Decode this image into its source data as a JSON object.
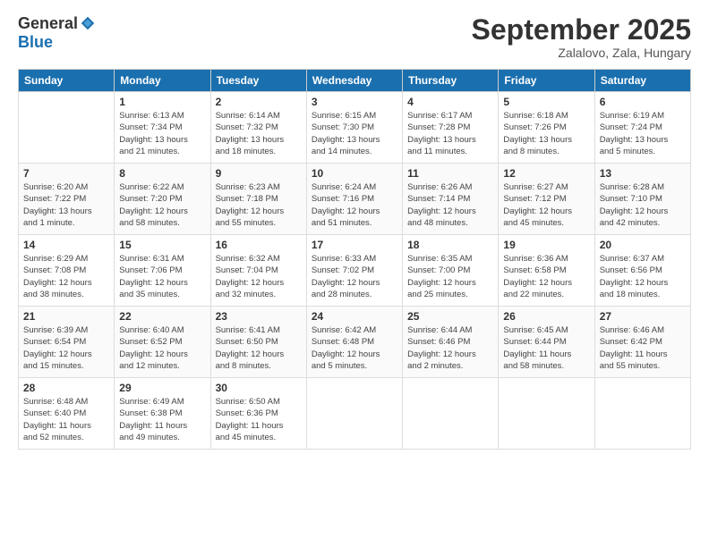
{
  "logo": {
    "general": "General",
    "blue": "Blue"
  },
  "header": {
    "month": "September 2025",
    "location": "Zalalovo, Zala, Hungary"
  },
  "weekdays": [
    "Sunday",
    "Monday",
    "Tuesday",
    "Wednesday",
    "Thursday",
    "Friday",
    "Saturday"
  ],
  "weeks": [
    [
      {
        "day": "",
        "info": ""
      },
      {
        "day": "1",
        "info": "Sunrise: 6:13 AM\nSunset: 7:34 PM\nDaylight: 13 hours\nand 21 minutes."
      },
      {
        "day": "2",
        "info": "Sunrise: 6:14 AM\nSunset: 7:32 PM\nDaylight: 13 hours\nand 18 minutes."
      },
      {
        "day": "3",
        "info": "Sunrise: 6:15 AM\nSunset: 7:30 PM\nDaylight: 13 hours\nand 14 minutes."
      },
      {
        "day": "4",
        "info": "Sunrise: 6:17 AM\nSunset: 7:28 PM\nDaylight: 13 hours\nand 11 minutes."
      },
      {
        "day": "5",
        "info": "Sunrise: 6:18 AM\nSunset: 7:26 PM\nDaylight: 13 hours\nand 8 minutes."
      },
      {
        "day": "6",
        "info": "Sunrise: 6:19 AM\nSunset: 7:24 PM\nDaylight: 13 hours\nand 5 minutes."
      }
    ],
    [
      {
        "day": "7",
        "info": "Sunrise: 6:20 AM\nSunset: 7:22 PM\nDaylight: 13 hours\nand 1 minute."
      },
      {
        "day": "8",
        "info": "Sunrise: 6:22 AM\nSunset: 7:20 PM\nDaylight: 12 hours\nand 58 minutes."
      },
      {
        "day": "9",
        "info": "Sunrise: 6:23 AM\nSunset: 7:18 PM\nDaylight: 12 hours\nand 55 minutes."
      },
      {
        "day": "10",
        "info": "Sunrise: 6:24 AM\nSunset: 7:16 PM\nDaylight: 12 hours\nand 51 minutes."
      },
      {
        "day": "11",
        "info": "Sunrise: 6:26 AM\nSunset: 7:14 PM\nDaylight: 12 hours\nand 48 minutes."
      },
      {
        "day": "12",
        "info": "Sunrise: 6:27 AM\nSunset: 7:12 PM\nDaylight: 12 hours\nand 45 minutes."
      },
      {
        "day": "13",
        "info": "Sunrise: 6:28 AM\nSunset: 7:10 PM\nDaylight: 12 hours\nand 42 minutes."
      }
    ],
    [
      {
        "day": "14",
        "info": "Sunrise: 6:29 AM\nSunset: 7:08 PM\nDaylight: 12 hours\nand 38 minutes."
      },
      {
        "day": "15",
        "info": "Sunrise: 6:31 AM\nSunset: 7:06 PM\nDaylight: 12 hours\nand 35 minutes."
      },
      {
        "day": "16",
        "info": "Sunrise: 6:32 AM\nSunset: 7:04 PM\nDaylight: 12 hours\nand 32 minutes."
      },
      {
        "day": "17",
        "info": "Sunrise: 6:33 AM\nSunset: 7:02 PM\nDaylight: 12 hours\nand 28 minutes."
      },
      {
        "day": "18",
        "info": "Sunrise: 6:35 AM\nSunset: 7:00 PM\nDaylight: 12 hours\nand 25 minutes."
      },
      {
        "day": "19",
        "info": "Sunrise: 6:36 AM\nSunset: 6:58 PM\nDaylight: 12 hours\nand 22 minutes."
      },
      {
        "day": "20",
        "info": "Sunrise: 6:37 AM\nSunset: 6:56 PM\nDaylight: 12 hours\nand 18 minutes."
      }
    ],
    [
      {
        "day": "21",
        "info": "Sunrise: 6:39 AM\nSunset: 6:54 PM\nDaylight: 12 hours\nand 15 minutes."
      },
      {
        "day": "22",
        "info": "Sunrise: 6:40 AM\nSunset: 6:52 PM\nDaylight: 12 hours\nand 12 minutes."
      },
      {
        "day": "23",
        "info": "Sunrise: 6:41 AM\nSunset: 6:50 PM\nDaylight: 12 hours\nand 8 minutes."
      },
      {
        "day": "24",
        "info": "Sunrise: 6:42 AM\nSunset: 6:48 PM\nDaylight: 12 hours\nand 5 minutes."
      },
      {
        "day": "25",
        "info": "Sunrise: 6:44 AM\nSunset: 6:46 PM\nDaylight: 12 hours\nand 2 minutes."
      },
      {
        "day": "26",
        "info": "Sunrise: 6:45 AM\nSunset: 6:44 PM\nDaylight: 11 hours\nand 58 minutes."
      },
      {
        "day": "27",
        "info": "Sunrise: 6:46 AM\nSunset: 6:42 PM\nDaylight: 11 hours\nand 55 minutes."
      }
    ],
    [
      {
        "day": "28",
        "info": "Sunrise: 6:48 AM\nSunset: 6:40 PM\nDaylight: 11 hours\nand 52 minutes."
      },
      {
        "day": "29",
        "info": "Sunrise: 6:49 AM\nSunset: 6:38 PM\nDaylight: 11 hours\nand 49 minutes."
      },
      {
        "day": "30",
        "info": "Sunrise: 6:50 AM\nSunset: 6:36 PM\nDaylight: 11 hours\nand 45 minutes."
      },
      {
        "day": "",
        "info": ""
      },
      {
        "day": "",
        "info": ""
      },
      {
        "day": "",
        "info": ""
      },
      {
        "day": "",
        "info": ""
      }
    ]
  ]
}
